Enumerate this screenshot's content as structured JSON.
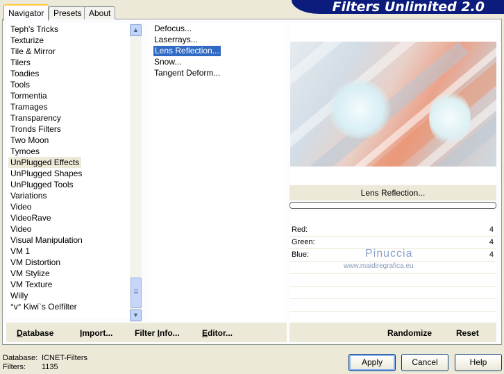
{
  "banner": {
    "title": "Filters Unlimited 2.0"
  },
  "tabs": [
    {
      "label": "Navigator",
      "active": true
    },
    {
      "label": "Presets",
      "active": false
    },
    {
      "label": "About",
      "active": false
    }
  ],
  "categories": [
    "Teph's Tricks",
    "Texturize",
    "Tile & Mirror",
    "Tilers",
    "Toadies",
    "Tools",
    "Tormentia",
    "Tramages",
    "Transparency",
    "Tronds Filters",
    "Two Moon",
    "Tymoes",
    "UnPlugged Effects",
    "UnPlugged Shapes",
    "UnPlugged Tools",
    "Variations",
    "Video",
    "VideoRave",
    "Video",
    "Visual Manipulation",
    "VM 1",
    "VM Distortion",
    "VM Stylize",
    "VM Texture",
    "Willy",
    "°v° Kiwi`s Oelfilter"
  ],
  "selected_category": "UnPlugged Effects",
  "filters": [
    "Defocus...",
    "Laserrays...",
    "Lens Reflection...",
    "Snow...",
    "Tangent Deform..."
  ],
  "selected_filter": "Lens Reflection...",
  "preview": {
    "label": "Lens Reflection..."
  },
  "params": [
    {
      "label": "Red:",
      "value": "4"
    },
    {
      "label": "Green:",
      "value": "4"
    },
    {
      "label": "Blue:",
      "value": "4"
    }
  ],
  "watermark": {
    "name": "Pinuccia",
    "url": "www.maidiregrafica.eu"
  },
  "toolbar": {
    "database": {
      "underline": "D",
      "rest": "atabase"
    },
    "import": {
      "underline": "I",
      "rest": "mport..."
    },
    "filter_info": {
      "pre": "Filter ",
      "underline": "I",
      "rest": "nfo..."
    },
    "editor": {
      "underline": "E",
      "rest": "ditor..."
    },
    "randomize": "Randomize",
    "reset": "Reset"
  },
  "status": {
    "database_label": "Database:",
    "database_value": "ICNET-Filters",
    "filters_label": "Filters:",
    "filters_value": "1135"
  },
  "buttons": {
    "apply": "Apply",
    "cancel": "Cancel",
    "help": "Help"
  },
  "colors": {
    "banner": "#0c1c7c",
    "selection": "#316ac5",
    "tab_highlight": "#ffc83c"
  },
  "icons": {
    "scroll_up": "chevron-up-icon",
    "scroll_down": "chevron-down-icon"
  }
}
